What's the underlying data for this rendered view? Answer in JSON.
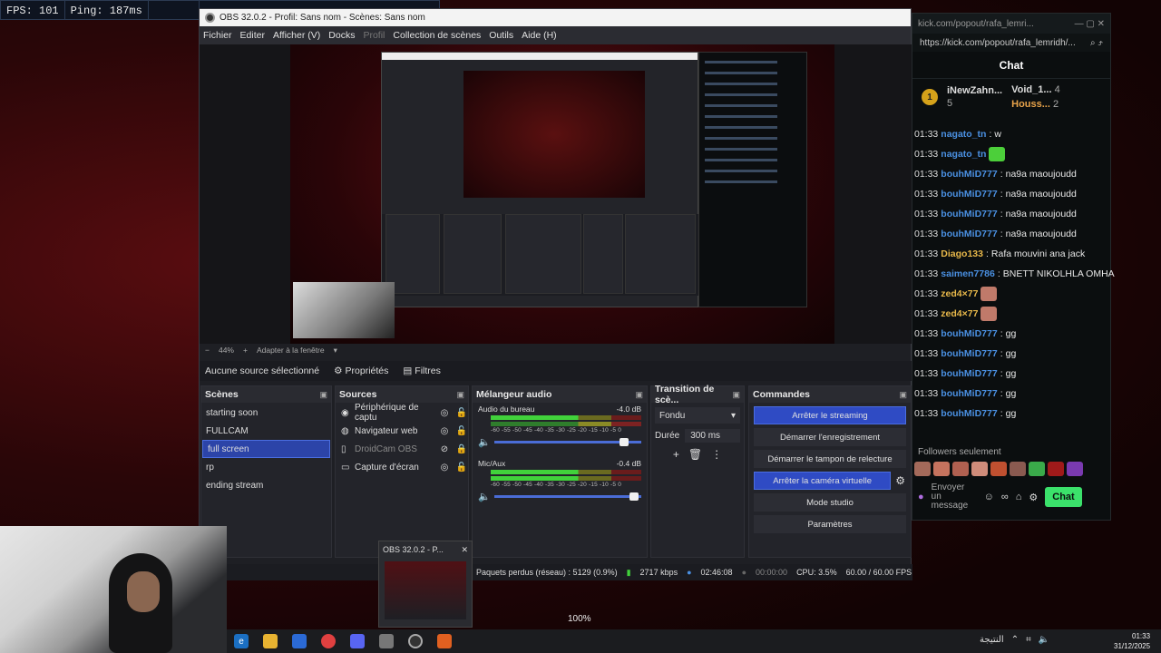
{
  "hud": {
    "fps": "FPS: 101",
    "ping": "Ping: 187ms"
  },
  "obs": {
    "title": "OBS 32.0.2 - Profil: Sans nom - Scènes: Sans nom",
    "menu": [
      "Fichier",
      "Editer",
      "Afficher (V)",
      "Docks",
      "Profil",
      "Collection de scènes",
      "Outils",
      "Aide (H)"
    ],
    "zoom": "44%",
    "fit": "Adapter à la fenêtre",
    "no_source": "Aucune source sélectionné",
    "properties": "Propriétés",
    "filters": "Filtres",
    "scenes": {
      "title": "Scènes",
      "items": [
        "starting soon",
        "FULLCAM",
        "full screen",
        "rp",
        "ending stream"
      ],
      "selected": 2
    },
    "sources": {
      "title": "Sources",
      "items": [
        {
          "name": "Périphérique de captu",
          "icon": "camera-icon",
          "dim": false
        },
        {
          "name": "Navigateur web",
          "icon": "globe-icon",
          "dim": false
        },
        {
          "name": "DroidCam OBS",
          "icon": "file-icon",
          "dim": true
        },
        {
          "name": "Capture d'écran",
          "icon": "monitor-icon",
          "dim": false
        }
      ]
    },
    "mixer": {
      "title": "Mélangeur audio",
      "channels": [
        {
          "name": "Audio du bureau",
          "db": "-4.0 dB",
          "level": 0.58,
          "volume": 0.9
        },
        {
          "name": "Mic/Aux",
          "db": "-0.4 dB",
          "level": 0.58,
          "volume": 1.0
        }
      ],
      "scale": "-60 -55 -50 -45 -40 -35 -30 -25 -20 -15 -10 -5 0"
    },
    "transition": {
      "title": "Transition de scè...",
      "type": "Fondu",
      "duration_label": "Durée",
      "duration": "300 ms"
    },
    "controls": {
      "title": "Commandes",
      "buttons": [
        {
          "label": "Arrêter le streaming",
          "active": true
        },
        {
          "label": "Démarrer l'enregistrement",
          "active": false
        },
        {
          "label": "Démarrer le tampon de relecture",
          "active": false
        },
        {
          "label": "Arrêter la caméra virtuelle",
          "active": true
        },
        {
          "label": "Mode studio",
          "active": false
        },
        {
          "label": "Paramètres",
          "active": false
        }
      ]
    },
    "status": {
      "dropped": "Paquets perdus (réseau) : 5129 (0.9%)",
      "bitrate": "2717 kbps",
      "live_time": "02:46:08",
      "rec_time": "00:00:00",
      "cpu": "CPU: 3.5%",
      "fps": "60.00 / 60.00 FPS"
    }
  },
  "thumb": {
    "title": "OBS 32.0.2 - P..."
  },
  "zoom_label": "100%",
  "chat": {
    "tab": "kick.com/popout/rafa_lemri...",
    "url": "https://kick.com/popout/rafa_lemridh/...",
    "header": "Chat",
    "leaders": [
      {
        "rank": "1",
        "name": "iNewZahn...",
        "count": "5"
      },
      {
        "name": "Void_1...",
        "count": "4"
      },
      {
        "name": "Houss...",
        "count": "2"
      }
    ],
    "messages": [
      {
        "time": "01:33",
        "user": "nagato_tn",
        "color": "#4a90e2",
        "text": "w"
      },
      {
        "time": "01:33",
        "user": "nagato_tn",
        "color": "#4a90e2",
        "text": "",
        "emote": "#4ccf3a"
      },
      {
        "time": "01:33",
        "user": "bouhMiD777",
        "color": "#4a90e2",
        "text": "na9a maoujoudd"
      },
      {
        "time": "01:33",
        "user": "bouhMiD777",
        "color": "#4a90e2",
        "text": "na9a maoujoudd"
      },
      {
        "time": "01:33",
        "user": "bouhMiD777",
        "color": "#4a90e2",
        "text": "na9a maoujoudd"
      },
      {
        "time": "01:33",
        "user": "bouhMiD777",
        "color": "#4a90e2",
        "text": "na9a maoujoudd"
      },
      {
        "time": "01:33",
        "user": "Diago133",
        "color": "#e8b84a",
        "text": "Rafa mouvini ana jack"
      },
      {
        "time": "01:33",
        "user": "saimen7786",
        "color": "#4a90e2",
        "text": "BNETT NIKOLHLA OMHA"
      },
      {
        "time": "01:33",
        "user": "zed4×77",
        "color": "#e8b84a",
        "text": "",
        "emote": "#c07a6a"
      },
      {
        "time": "01:33",
        "user": "zed4×77",
        "color": "#e8b84a",
        "text": "",
        "emote": "#c07a6a"
      },
      {
        "time": "01:33",
        "user": "bouhMiD777",
        "color": "#4a90e2",
        "text": "gg"
      },
      {
        "time": "01:33",
        "user": "bouhMiD777",
        "color": "#4a90e2",
        "text": "gg"
      },
      {
        "time": "01:33",
        "user": "bouhMiD777",
        "color": "#4a90e2",
        "text": "gg"
      },
      {
        "time": "01:33",
        "user": "bouhMiD777",
        "color": "#4a90e2",
        "text": "gg"
      },
      {
        "time": "01:33",
        "user": "bouhMiD777",
        "color": "#4a90e2",
        "text": "gg"
      }
    ],
    "followers_only": "Followers seulement",
    "placeholder": "Envoyer un message",
    "send": "Chat"
  },
  "clock": {
    "time": "01:33",
    "date": "31/12/2025"
  },
  "tray_label": "النتيجة"
}
